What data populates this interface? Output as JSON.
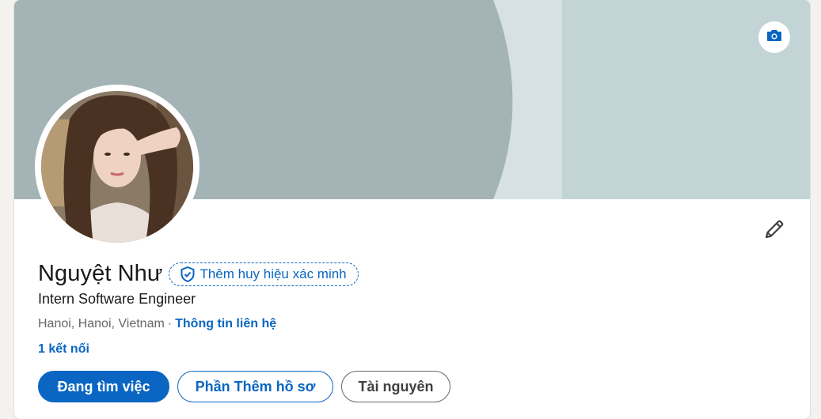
{
  "profile": {
    "name": "Nguyệt Như",
    "verify_badge_label": "Thêm huy hiệu xác minh",
    "headline": "Intern Software Engineer",
    "location": "Hanoi, Hanoi, Vietnam",
    "separator": "·",
    "contact_info_label": "Thông tin liên hệ",
    "connections_label": "1 kết nối"
  },
  "actions": {
    "open_to_work": "Đang tìm việc",
    "add_profile_section": "Phần Thêm hồ sơ",
    "resources": "Tài nguyên"
  },
  "icons": {
    "camera": "camera-icon",
    "edit": "pencil-icon",
    "verify": "shield-check-icon"
  },
  "colors": {
    "accent": "#0a66c2",
    "banner_light": "#c3d4d6",
    "banner_dark": "#a3b3b6",
    "banner_stripe": "#d7e1e3",
    "page_bg": "#f4f2ee"
  }
}
